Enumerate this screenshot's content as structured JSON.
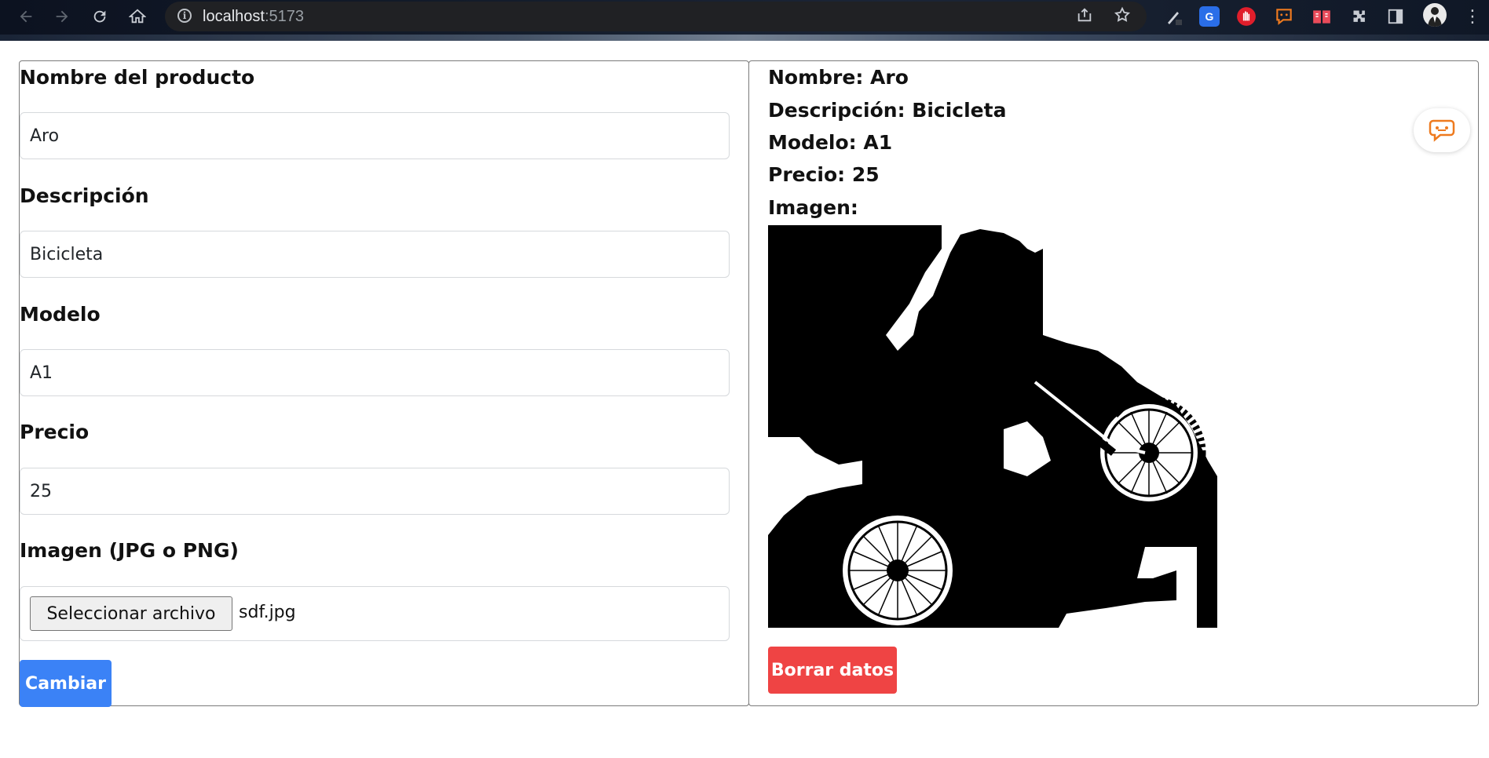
{
  "browser": {
    "url_host": "localhost",
    "url_port": ":5173",
    "extension_names": [
      "pen-tool-icon",
      "translate-icon",
      "stop-hand-icon",
      "chat-icon",
      "book-icon",
      "puzzle-icon",
      "sidepanel-icon",
      "profile-avatar"
    ]
  },
  "form": {
    "fields": [
      {
        "label": "Nombre del producto",
        "value": "Aro"
      },
      {
        "label": "Descripción",
        "value": "Bicicleta"
      },
      {
        "label": "Modelo",
        "value": "A1"
      },
      {
        "label": "Precio",
        "value": "25"
      }
    ],
    "image_label": "Imagen (JPG o PNG)",
    "file_button_label": "Seleccionar archivo",
    "file_name": "sdf.jpg",
    "submit_label": "Cambiar"
  },
  "details": {
    "nombre": "Nombre: Aro",
    "descripcion": "Descripción: Bicicleta",
    "modelo": "Modelo: A1",
    "precio": "Precio: 25",
    "imagen": "Imagen:",
    "image_subject": "motocross-rider-silhouette",
    "delete_label": "Borrar datos"
  },
  "colors": {
    "primary_button": "#3b82f6",
    "danger_button": "#ef4444",
    "chat_accent": "#ee7a1f"
  }
}
